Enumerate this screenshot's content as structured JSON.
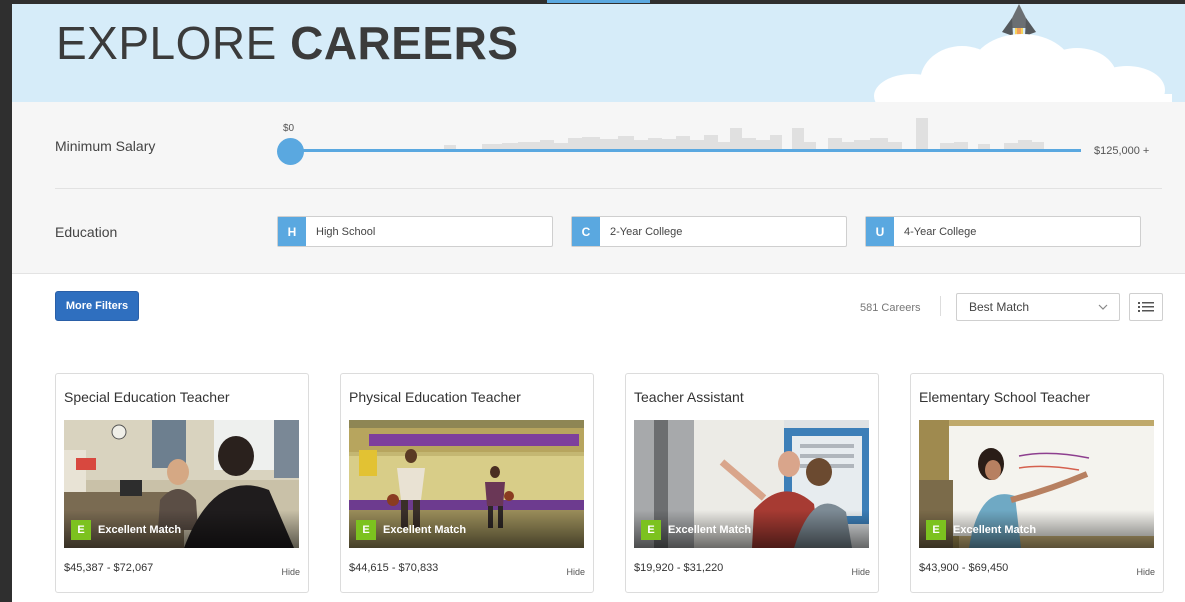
{
  "hero": {
    "title_light": "EXPLORE",
    "title_bold": "CAREERS"
  },
  "filters": {
    "salary": {
      "label": "Minimum Salary",
      "min_label": "$0",
      "max_label": "$125,000 +",
      "value_fraction": 0
    },
    "education": {
      "label": "Education",
      "options": [
        {
          "letter": "H",
          "label": "High School"
        },
        {
          "letter": "C",
          "label": "2-Year College"
        },
        {
          "letter": "U",
          "label": "4-Year College"
        }
      ]
    }
  },
  "toolbar": {
    "more_filters_label": "More Filters",
    "count_text": "581 Careers",
    "sort_value": "Best Match"
  },
  "cards": [
    {
      "title": "Special Education Teacher",
      "match_letter": "E",
      "match_label": "Excellent Match",
      "salary": "$45,387 - $72,067",
      "hide_label": "Hide"
    },
    {
      "title": "Physical Education Teacher",
      "match_letter": "E",
      "match_label": "Excellent Match",
      "salary": "$44,615 - $70,833",
      "hide_label": "Hide"
    },
    {
      "title": "Teacher Assistant",
      "match_letter": "E",
      "match_label": "Excellent Match",
      "salary": "$19,920 - $31,220",
      "hide_label": "Hide"
    },
    {
      "title": "Elementary School Teacher",
      "match_letter": "E",
      "match_label": "Excellent Match",
      "salary": "$43,900 - $69,450",
      "hide_label": "Hide"
    }
  ],
  "colors": {
    "accent": "#5aa8e0",
    "primary_button": "#2f6fbf",
    "match_green": "#7cc21f",
    "hero_bg": "#d6ecf9"
  },
  "icons": {
    "rocket": "rocket-icon",
    "cloud": "cloud-icon",
    "chevron": "chevron-down-icon",
    "list_view": "list-view-icon"
  }
}
